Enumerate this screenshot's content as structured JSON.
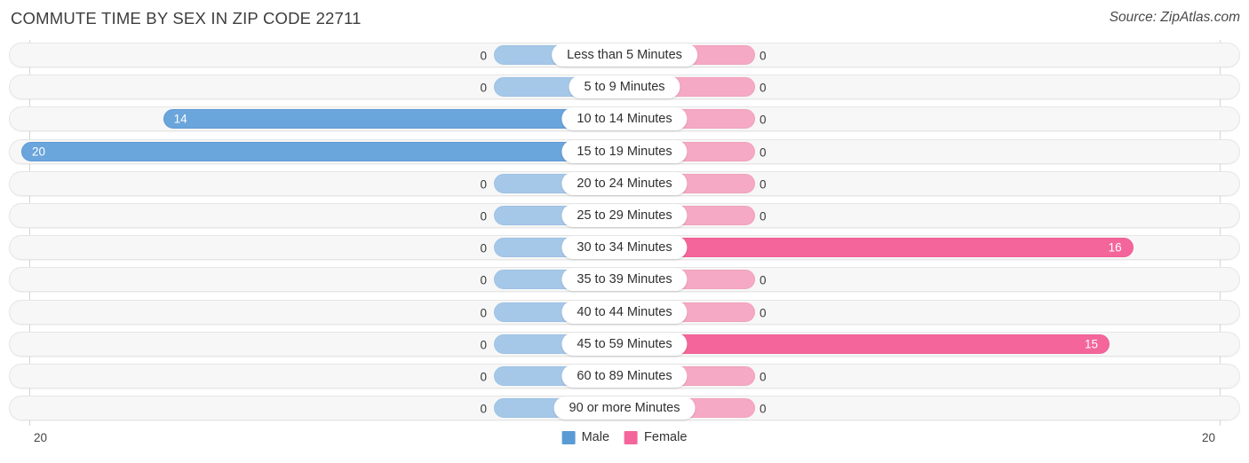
{
  "header": {
    "title": "COMMUTE TIME BY SEX IN ZIP CODE 22711",
    "source": "Source: ZipAtlas.com"
  },
  "legend": {
    "male_label": "Male",
    "female_label": "Female",
    "male_color": "#5b9bd5",
    "female_color": "#f4669b"
  },
  "axis": {
    "left_tick": "20",
    "right_tick": "20"
  },
  "chart_data": {
    "type": "bar",
    "title": "COMMUTE TIME BY SEX IN ZIP CODE 22711",
    "subtitle": "Source: ZipAtlas.com",
    "orientation": "horizontal-diverging",
    "xlabel": "",
    "ylabel": "",
    "xlim": [
      20,
      20
    ],
    "grid": false,
    "legend_position": "bottom-center",
    "categories": [
      "Less than 5 Minutes",
      "5 to 9 Minutes",
      "10 to 14 Minutes",
      "15 to 19 Minutes",
      "20 to 24 Minutes",
      "25 to 29 Minutes",
      "30 to 34 Minutes",
      "35 to 39 Minutes",
      "40 to 44 Minutes",
      "45 to 59 Minutes",
      "60 to 89 Minutes",
      "90 or more Minutes"
    ],
    "series": [
      {
        "name": "Male",
        "color": "#5b9bd5",
        "values": [
          0,
          0,
          14,
          20,
          0,
          0,
          0,
          0,
          0,
          0,
          0,
          0
        ],
        "labels": [
          "0",
          "0",
          "14",
          "20",
          "0",
          "0",
          "0",
          "0",
          "0",
          "0",
          "0",
          "0"
        ]
      },
      {
        "name": "Female",
        "color": "#f4669b",
        "values": [
          0,
          0,
          0,
          0,
          0,
          0,
          16,
          0,
          0,
          15,
          0,
          0
        ],
        "labels": [
          "0",
          "0",
          "0",
          "0",
          "0",
          "0",
          "16",
          "0",
          "0",
          "15",
          "0",
          "0"
        ]
      }
    ]
  }
}
